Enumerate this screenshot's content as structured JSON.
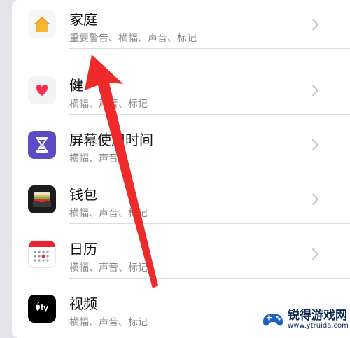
{
  "settings": {
    "items": [
      {
        "title": "家庭",
        "subtitle": "重要警告、横幅、声音、标记",
        "icon": "home-icon",
        "color": "#f5b731"
      },
      {
        "title": "健",
        "subtitle": "横幅、声音、标记",
        "icon": "health-heart-icon",
        "color": "#fa2d55"
      },
      {
        "title": "屏幕使用时间",
        "subtitle": "横幅、声音",
        "icon": "hourglass-icon",
        "color": "#5b4cc4"
      },
      {
        "title": "钱包",
        "subtitle": "横幅、声音、标记",
        "icon": "wallet-icon",
        "color": "#1c1c1e"
      },
      {
        "title": "日历",
        "subtitle": "横幅、声音、标记",
        "icon": "calendar-icon",
        "color": "#e8262e"
      },
      {
        "title": "视频",
        "subtitle": "横幅、声音、标记",
        "icon": "apple-tv-icon",
        "color": "#000000"
      }
    ]
  },
  "watermark": {
    "name": "锐得游戏网",
    "url": "www.ytruida.com"
  },
  "colors": {
    "background": "#e4e3e9",
    "annotation_arrow": "#ee2a2a"
  }
}
